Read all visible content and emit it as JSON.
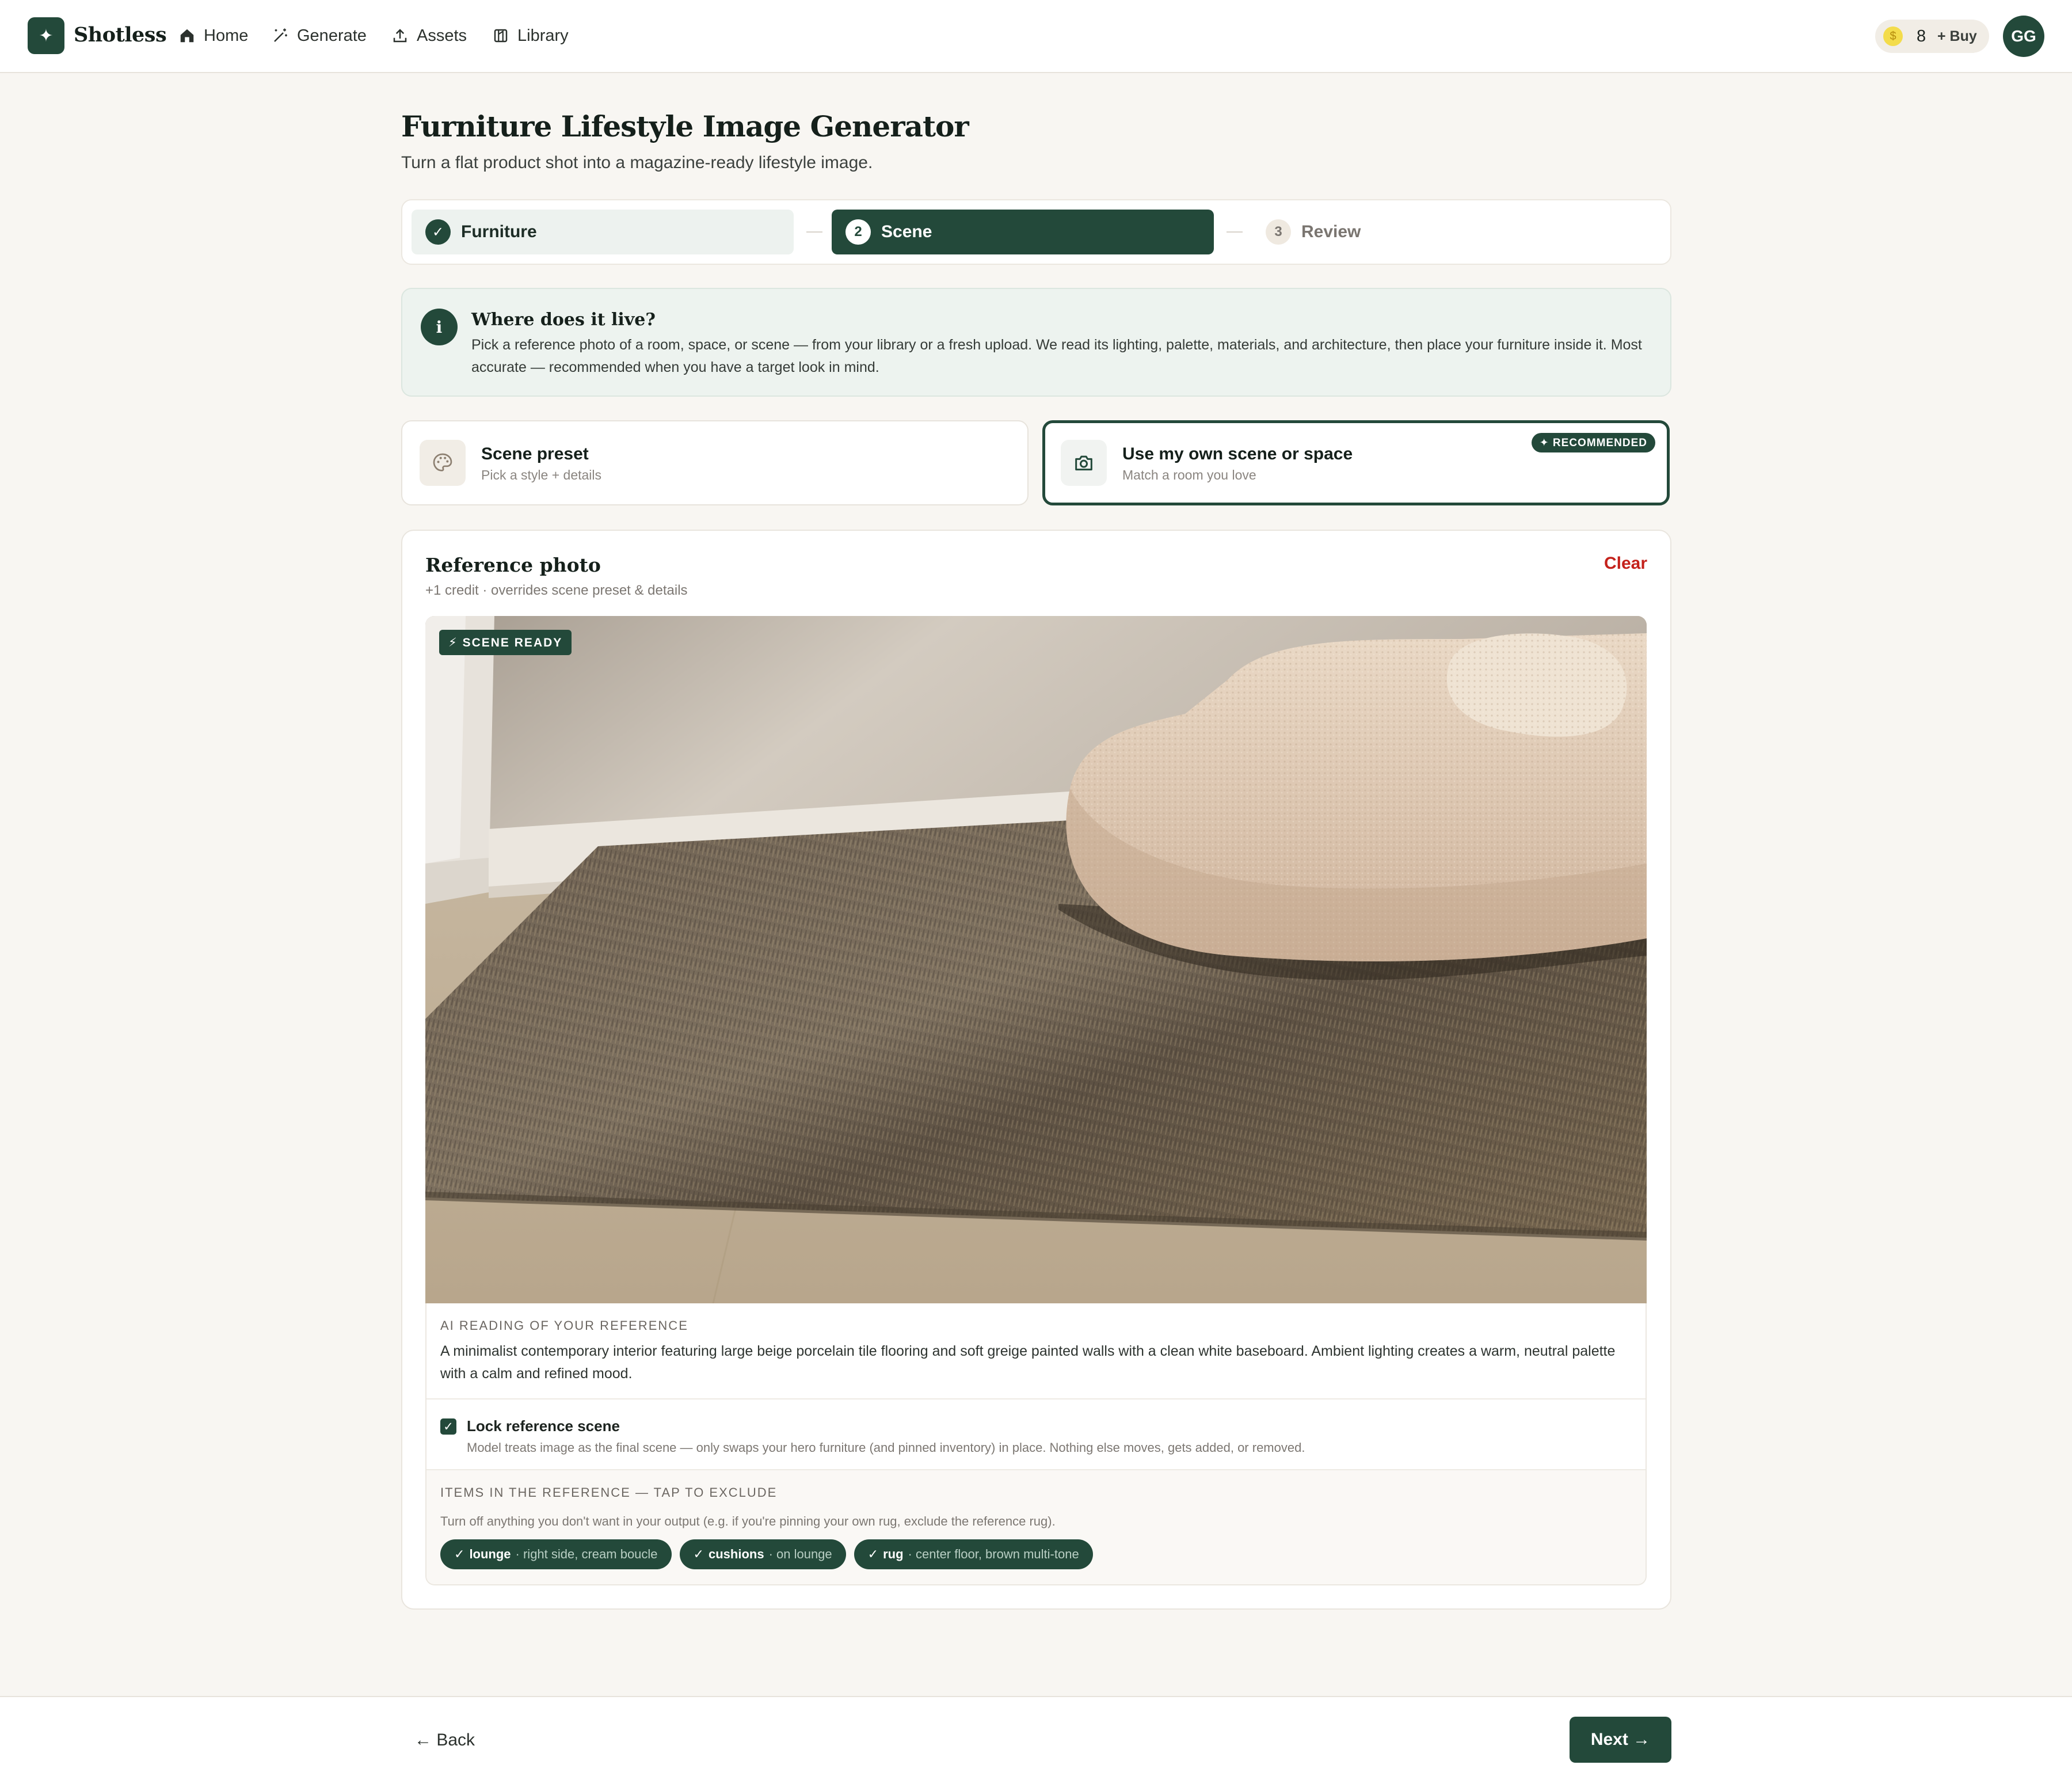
{
  "app": {
    "brand": "Shotless",
    "logo_glyph": "✦",
    "accent_color": "#23493a"
  },
  "nav": {
    "items": [
      {
        "label": "Home",
        "icon": "home-icon"
      },
      {
        "label": "Generate",
        "icon": "wand-icon"
      },
      {
        "label": "Assets",
        "icon": "upload-icon"
      },
      {
        "label": "Library",
        "icon": "library-icon"
      }
    ],
    "credits": "8",
    "buy_label": "+ Buy",
    "avatar_initials": "GG"
  },
  "header": {
    "title": "Furniture Lifestyle Image Generator",
    "subtitle": "Turn a flat product shot into a magazine-ready lifestyle image."
  },
  "stepper": {
    "steps": [
      {
        "number": "✓",
        "label": "Furniture",
        "state": "complete"
      },
      {
        "number": "2",
        "label": "Scene",
        "state": "active"
      },
      {
        "number": "3",
        "label": "Review",
        "state": "upcoming"
      }
    ]
  },
  "info": {
    "icon_glyph": "i",
    "title": "Where does it live?",
    "body": "Pick a reference photo of a room, space, or scene — from your library or a fresh upload. We read its lighting, palette, materials, and architecture, then place your furniture inside it. Most accurate — recommended when you have a target look in mind."
  },
  "modes": {
    "preset": {
      "title": "Scene preset",
      "subtitle": "Pick a style + details",
      "icon": "palette-icon"
    },
    "own": {
      "title": "Use my own scene or space",
      "subtitle": "Match a room you love",
      "icon": "camera-icon",
      "badge": "✦ RECOMMENDED",
      "selected": true
    }
  },
  "reference": {
    "title": "Reference photo",
    "subtitle": "+1 credit · overrides scene preset & details",
    "clear_label": "Clear",
    "badge": "⚡ SCENE READY",
    "ai_label": "AI READING OF YOUR REFERENCE",
    "ai_text": "A minimalist contemporary interior featuring large beige porcelain tile flooring and soft greige painted walls with a clean white baseboard. Ambient lighting creates a warm, neutral palette with a calm and refined mood.",
    "lock": {
      "checked": true,
      "check_glyph": "✓",
      "title": "Lock reference scene",
      "description": "Model treats image as the final scene — only swaps your hero furniture (and pinned inventory) in place. Nothing else moves, gets added, or removed."
    },
    "items_label": "ITEMS IN THE REFERENCE — TAP TO EXCLUDE",
    "items_desc": "Turn off anything you don't want in your output (e.g. if you're pinning your own rug, exclude the reference rug).",
    "items": [
      {
        "check": "✓",
        "name": "lounge",
        "detail": "· right side, cream boucle"
      },
      {
        "check": "✓",
        "name": "cushions",
        "detail": "· on lounge"
      },
      {
        "check": "✓",
        "name": "rug",
        "detail": "· center floor, brown multi-tone"
      }
    ]
  },
  "footer": {
    "back_label": "← Back",
    "next_label": "Next →"
  }
}
